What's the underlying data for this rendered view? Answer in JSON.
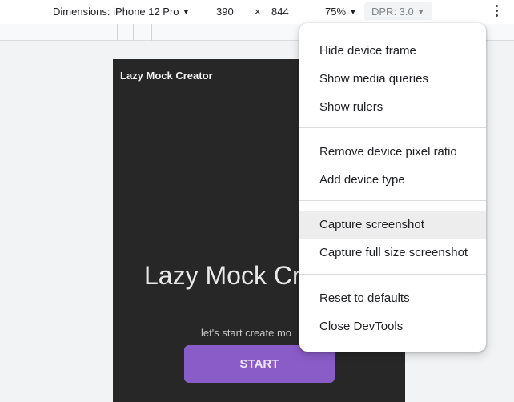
{
  "toolbar": {
    "dimensions_label": "Dimensions: iPhone 12 Pro",
    "width": "390",
    "times": "×",
    "height": "844",
    "zoom": "75%",
    "dpr": "DPR: 3.0",
    "caret_icon": "▼",
    "more_icon": "kebab-menu-icon"
  },
  "device": {
    "app_bar_title": "Lazy Mock Creator",
    "hero_title": "Lazy Mock Cr",
    "hero_subtitle": "let's start create mo",
    "start_label": "START",
    "background": "#272727",
    "button_color": "#8a5cc8"
  },
  "menu": {
    "hide_frame": "Hide device frame",
    "show_media": "Show media queries",
    "show_rulers": "Show rulers",
    "remove_dpr": "Remove device pixel ratio",
    "add_device": "Add device type",
    "capture": "Capture screenshot",
    "capture_full": "Capture full size screenshot",
    "reset": "Reset to defaults",
    "close": "Close DevTools",
    "highlighted_item": "Capture screenshot"
  }
}
